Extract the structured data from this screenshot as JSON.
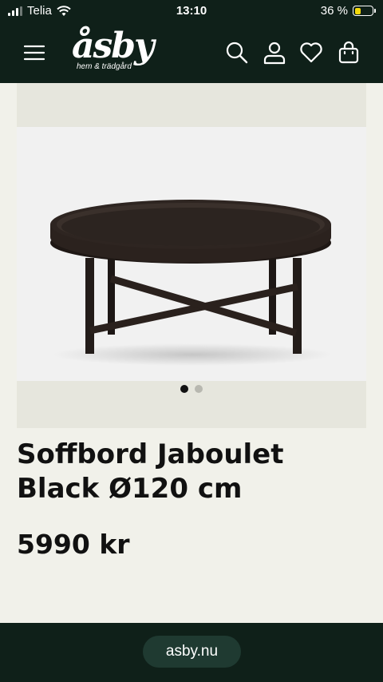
{
  "status_bar": {
    "carrier": "Telia",
    "time": "13:10",
    "battery_percent": "36 %",
    "battery_level": 0.36
  },
  "header": {
    "logo_text": "åsby",
    "logo_subtitle": "hem & trädgård",
    "icons": [
      "menu-icon",
      "search-icon",
      "account-icon",
      "wishlist-heart-icon",
      "cart-bag-icon"
    ]
  },
  "gallery": {
    "image_count": 2,
    "active_index": 0
  },
  "product": {
    "name": "Soffbord Jaboulet Black Ø120 cm",
    "price": "5990 kr"
  },
  "browser": {
    "url": "asby.nu"
  },
  "colors": {
    "header_bg": "#0f2019",
    "page_bg": "#f1f1ea",
    "battery_fill": "#f5d90a"
  }
}
